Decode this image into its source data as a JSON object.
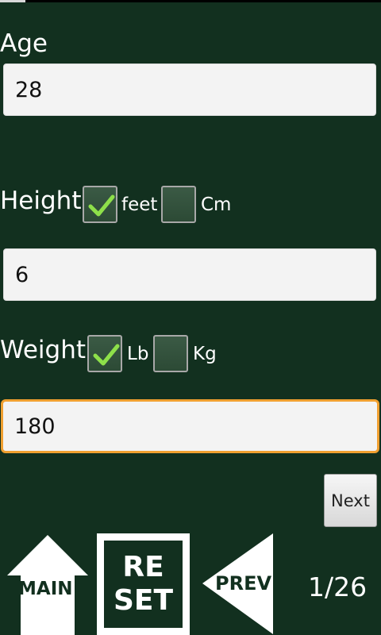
{
  "form": {
    "age_label": "Age",
    "age_value": "28",
    "height_label": "Height",
    "height_unit_feet": "feet",
    "height_unit_cm": "Cm",
    "height_value": "6",
    "weight_label": "Weight",
    "weight_unit_lb": "Lb",
    "weight_unit_kg": "Kg",
    "weight_value": "180"
  },
  "checkboxes": {
    "feet_checked": true,
    "cm_checked": false,
    "lb_checked": true,
    "kg_checked": false
  },
  "actions": {
    "next_label": "Next",
    "main_label": "MAIN",
    "reset_line1": "RE",
    "reset_line2": "SET",
    "prev_label": "PREV"
  },
  "pagination": {
    "page_counter": "1/26"
  },
  "colors": {
    "background": "#12301f",
    "focus_border": "#f0a030",
    "check_mark": "#8ee04a"
  }
}
